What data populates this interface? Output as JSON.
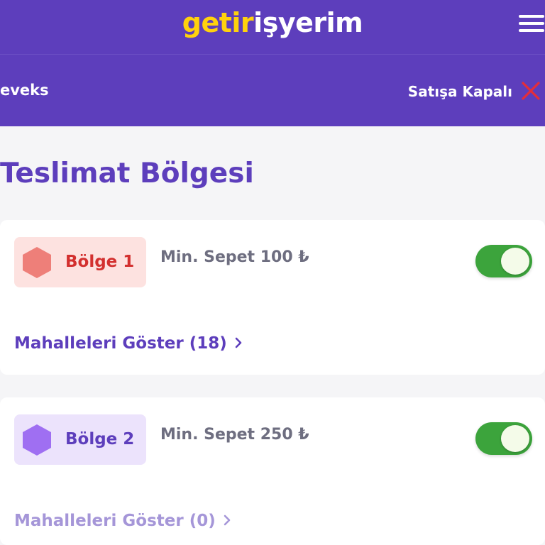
{
  "header": {
    "logo_part1": "getir",
    "logo_part2": "işyerim",
    "menu_icon": "hamburger-menu-icon"
  },
  "store_bar": {
    "store_name": "eveks",
    "status_label": "Satışa Kapalı",
    "status_icon": "close-icon"
  },
  "page": {
    "title": "Teslimat Bölgesi"
  },
  "zones": [
    {
      "label": "Bölge 1",
      "min_basket": "Min. Sepet 100 ₺",
      "enabled": true,
      "link_label": "Mahalleleri Göster (18)",
      "badge_bg": "#fde2e0",
      "hex_color": "#ee7f79",
      "label_color": "#d3302f",
      "link_color": "#5d3ebc"
    },
    {
      "label": "Bölge 2",
      "min_basket": "Min. Sepet 250 ₺",
      "enabled": true,
      "link_label": "Mahalleleri Göster (0)",
      "badge_bg": "#ece3fc",
      "hex_color": "#9f6ff2",
      "label_color": "#5d3ebc",
      "link_color": "#a596d8"
    }
  ],
  "colors": {
    "brand_purple": "#5d3ebc",
    "brand_yellow": "#ffd10d",
    "toggle_on": "#3ca43c",
    "close_red": "#e52d3a"
  }
}
